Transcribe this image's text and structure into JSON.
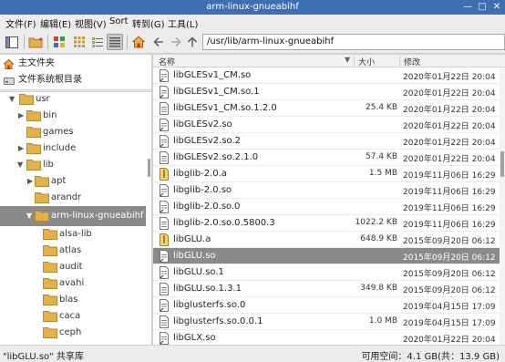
{
  "window": {
    "title": "arm-linux-gnueabihf",
    "minimize": "—",
    "maximize": "□",
    "close": "✕"
  },
  "menu": [
    "文件(F)",
    "编辑(E)",
    "视图(V)",
    "Sort",
    "转到(G)",
    "工具(L)"
  ],
  "location": "/usr/lib/arm-linux-gnueabihf",
  "places": [
    {
      "label": "主文件夹",
      "icon": "home-icon"
    },
    {
      "label": "文件系统根目录",
      "icon": "drive-icon"
    }
  ],
  "tree": [
    {
      "label": "usr",
      "indent": 0,
      "arrow": "down"
    },
    {
      "label": "bin",
      "indent": 1,
      "arrow": "right"
    },
    {
      "label": "games",
      "indent": 1,
      "arrow": "none"
    },
    {
      "label": "include",
      "indent": 1,
      "arrow": "right"
    },
    {
      "label": "lib",
      "indent": 1,
      "arrow": "down"
    },
    {
      "label": "apt",
      "indent": 2,
      "arrow": "right"
    },
    {
      "label": "arandr",
      "indent": 2,
      "arrow": "none"
    },
    {
      "label": "arm-linux-gnueabihf",
      "indent": 2,
      "arrow": "down",
      "selected": true
    },
    {
      "label": "alsa-lib",
      "indent": 3,
      "arrow": "none"
    },
    {
      "label": "atlas",
      "indent": 3,
      "arrow": "none"
    },
    {
      "label": "audit",
      "indent": 3,
      "arrow": "none"
    },
    {
      "label": "avahi",
      "indent": 3,
      "arrow": "none"
    },
    {
      "label": "blas",
      "indent": 3,
      "arrow": "none"
    },
    {
      "label": "caca",
      "indent": 3,
      "arrow": "none"
    },
    {
      "label": "ceph",
      "indent": 3,
      "arrow": "none"
    }
  ],
  "columns": {
    "name": "名称",
    "size": "大小",
    "modified": "修改",
    "sort_indicator": "▼"
  },
  "files": [
    {
      "name": "libGLESv1_CM.so",
      "size": "",
      "date": "2020年01月22日 20:04",
      "icon": "link"
    },
    {
      "name": "libGLESv1_CM.so.1",
      "size": "",
      "date": "2020年01月22日 20:04",
      "icon": "link"
    },
    {
      "name": "libGLESv1_CM.so.1.2.0",
      "size": "25.4 KB",
      "date": "2020年01月22日 20:04",
      "icon": "lib"
    },
    {
      "name": "libGLESv2.so",
      "size": "",
      "date": "2020年01月22日 20:04",
      "icon": "link"
    },
    {
      "name": "libGLESv2.so.2",
      "size": "",
      "date": "2020年01月22日 20:04",
      "icon": "link"
    },
    {
      "name": "libGLESv2.so.2.1.0",
      "size": "57.4 KB",
      "date": "2020年01月22日 20:04",
      "icon": "lib"
    },
    {
      "name": "libglib-2.0.a",
      "size": "1.5 MB",
      "date": "2019年11月06日 16:29",
      "icon": "archive"
    },
    {
      "name": "libglib-2.0.so",
      "size": "",
      "date": "2019年11月06日 16:29",
      "icon": "link"
    },
    {
      "name": "libglib-2.0.so.0",
      "size": "",
      "date": "2019年11月06日 16:29",
      "icon": "link"
    },
    {
      "name": "libglib-2.0.so.0.5800.3",
      "size": "1022.2 KB",
      "date": "2019年11月06日 16:29",
      "icon": "lib"
    },
    {
      "name": "libGLU.a",
      "size": "648.9 KB",
      "date": "2015年09月20日 06:12",
      "icon": "archive"
    },
    {
      "name": "libGLU.so",
      "size": "",
      "date": "2015年09月20日 06:12",
      "icon": "link",
      "selected": true
    },
    {
      "name": "libGLU.so.1",
      "size": "",
      "date": "2015年09月20日 06:12",
      "icon": "link"
    },
    {
      "name": "libGLU.so.1.3.1",
      "size": "349.8 KB",
      "date": "2015年09月20日 06:12",
      "icon": "lib"
    },
    {
      "name": "libglusterfs.so.0",
      "size": "",
      "date": "2019年04月15日 17:09",
      "icon": "link"
    },
    {
      "name": "libglusterfs.so.0.0.1",
      "size": "1.0 MB",
      "date": "2019年04月15日 17:09",
      "icon": "lib"
    },
    {
      "name": "libGLX.so",
      "size": "",
      "date": "2020年01月22日 20:04",
      "icon": "link"
    }
  ],
  "status": {
    "left": "\"libGLU.so\" 共享库",
    "right": "可用空间：4.1 GB(共：13.9 GB)"
  },
  "colors": {
    "titlebar": "#3f6fb3",
    "folder": "#e3b04a",
    "selection": "#8a8a8a"
  }
}
